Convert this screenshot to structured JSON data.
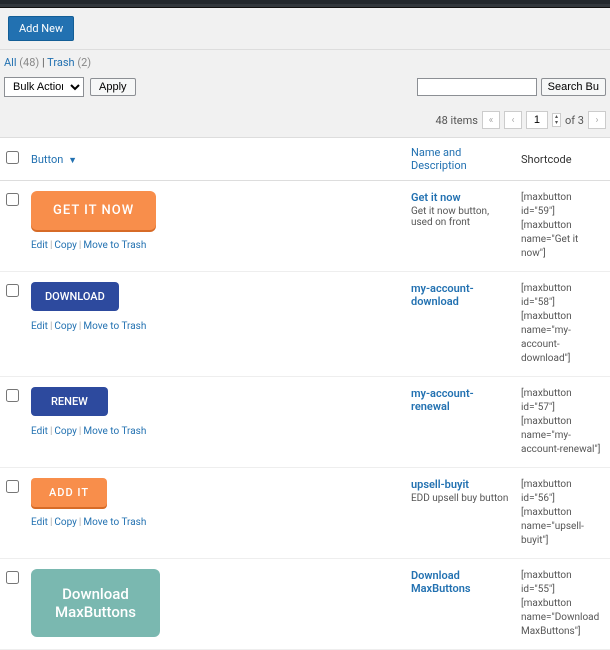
{
  "header": {
    "add_new": "Add New"
  },
  "filters": {
    "all_label": "All",
    "all_count": "(48)",
    "trash_label": "Trash",
    "trash_count": "(2)"
  },
  "bulk": {
    "placeholder_option": "Bulk Actions",
    "apply": "Apply"
  },
  "search": {
    "button": "Search Bu"
  },
  "pagination": {
    "items_label": "48 items",
    "prev2": "«",
    "prev": "‹",
    "page": "1",
    "of_label": "of 3",
    "next": "›"
  },
  "columns": {
    "button": "Button",
    "name": "Name and Description",
    "shortcode": "Shortcode",
    "sort_ind": "▼"
  },
  "row_actions": {
    "edit": "Edit",
    "copy": "Copy",
    "trash": "Move to Trash"
  },
  "rows": [
    {
      "preview_text": "GET IT NOW",
      "preview_class": "btn-getitnow",
      "name": "Get it now",
      "desc": "Get it now button, used on front",
      "shortcode1": "[maxbutton id=\"59\"]",
      "shortcode2": "[maxbutton name=\"Get it now\"]"
    },
    {
      "preview_text": "DOWNLOAD",
      "preview_class": "btn-download",
      "name": "my-account-download",
      "desc": "",
      "shortcode1": "[maxbutton id=\"58\"]",
      "shortcode2": "[maxbutton name=\"my-account-download\"]"
    },
    {
      "preview_text": "RENEW",
      "preview_class": "btn-renew",
      "name": "my-account-renewal",
      "desc": "",
      "shortcode1": "[maxbutton id=\"57\"]",
      "shortcode2": "[maxbutton name=\"my-account-renewal\"]"
    },
    {
      "preview_text": "ADD IT",
      "preview_class": "btn-addit",
      "name": "upsell-buyit",
      "desc": "EDD upsell buy button",
      "shortcode1": "[maxbutton id=\"56\"]",
      "shortcode2": "[maxbutton name=\"upsell-buyit\"]"
    },
    {
      "preview_text": "Download\nMaxButtons",
      "preview_class": "btn-dlmax",
      "name": "Download MaxButtons",
      "desc": "",
      "shortcode1": "[maxbutton id=\"55\"]",
      "shortcode2": "[maxbutton name=\"Download MaxButtons\"]"
    }
  ]
}
